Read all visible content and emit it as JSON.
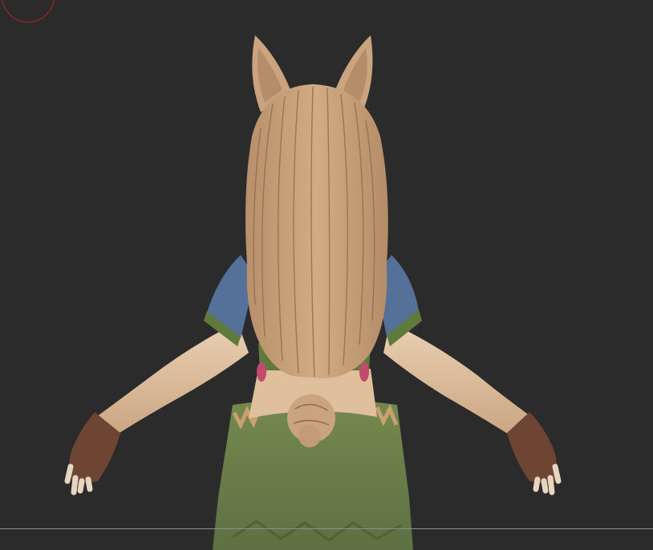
{
  "viewport": {
    "background": "#2b2b2b",
    "gizmo_color": "#b5222a",
    "floor_line_color": "#8f8f8f"
  },
  "model": {
    "view": "back",
    "colors": {
      "hair": "#c7a07a",
      "hair_shadow": "#8f6a4c",
      "skin": "#e3c4a4",
      "skin_shadow": "#caa482",
      "sleeve": "#55719a",
      "trim": "#5f7a3c",
      "skirt": "#6a7e4c",
      "glove": "#6d4532",
      "pink_accent": "#c24a6e"
    }
  }
}
